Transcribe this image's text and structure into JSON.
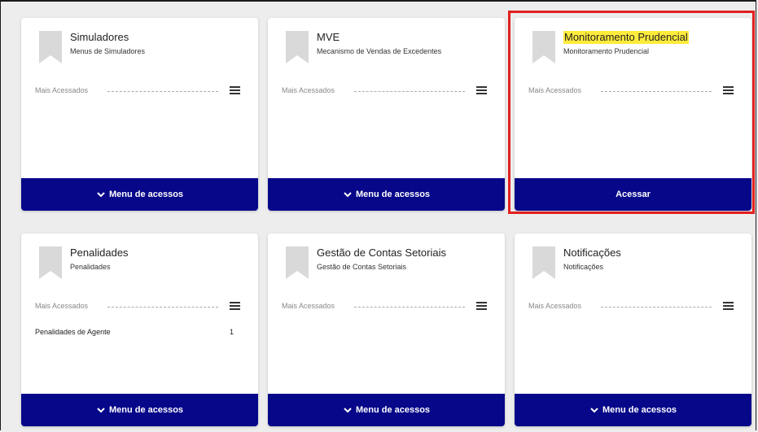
{
  "cards": [
    {
      "title": "Simuladores",
      "subtitle": "Menus de Simuladores",
      "mais_label": "Mais Acessados",
      "button_label": "Menu de acessos",
      "items": []
    },
    {
      "title": "MVE",
      "subtitle": "Mecanismo de Vendas de Excedentes",
      "mais_label": "Mais Acessados",
      "button_label": "Menu de acessos",
      "items": []
    },
    {
      "title": "Monitoramento Prudencial",
      "subtitle": "Monitoramento Prudencial",
      "mais_label": "Mais Acessados",
      "button_label": "Acessar",
      "items": []
    },
    {
      "title": "Penalidades",
      "subtitle": "Penalidades",
      "mais_label": "Mais Acessados",
      "button_label": "Menu de acessos",
      "items": [
        {
          "label": "Penalidades de Agente",
          "count": "1"
        }
      ]
    },
    {
      "title": "Gestão de Contas Setoriais",
      "subtitle": "Gestão de Contas Setoriais",
      "mais_label": "Mais Acessados",
      "button_label": "Menu de acessos",
      "items": []
    },
    {
      "title": "Notificações",
      "subtitle": "Notificações",
      "mais_label": "Mais Acessados",
      "button_label": "Menu de acessos",
      "items": []
    }
  ],
  "icons": {
    "card_icon": "bookmark-icon",
    "menu_icon": "hamburger-menu-icon",
    "button_icon": "chevron-down-icon"
  },
  "colors": {
    "button_bg": "#07078a",
    "highlight_border": "#e21f1f",
    "title_highlight": "#ffeb3b"
  }
}
